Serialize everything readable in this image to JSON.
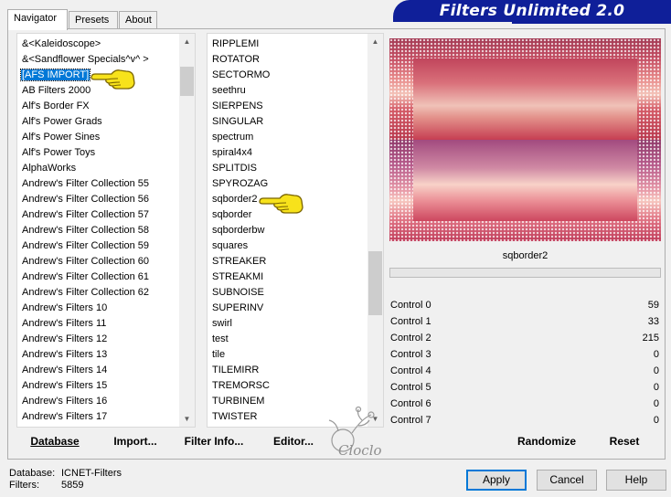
{
  "tabs": [
    {
      "label": "Navigator",
      "active": true
    },
    {
      "label": "Presets",
      "active": false
    },
    {
      "label": "About",
      "active": false
    }
  ],
  "brand": "Filters Unlimited 2.0",
  "categories": [
    "&<Kaleidoscope>",
    "&<Sandflower Specials^v^ >",
    "[AFS IMPORT]",
    "AB Filters 2000",
    "Alf's Border FX",
    "Alf's Power Grads",
    "Alf's Power Sines",
    "Alf's Power Toys",
    "AlphaWorks",
    "Andrew's Filter Collection 55",
    "Andrew's Filter Collection 56",
    "Andrew's Filter Collection 57",
    "Andrew's Filter Collection 58",
    "Andrew's Filter Collection 59",
    "Andrew's Filter Collection 60",
    "Andrew's Filter Collection 61",
    "Andrew's Filter Collection 62",
    "Andrew's Filters 10",
    "Andrew's Filters 11",
    "Andrew's Filters 12",
    "Andrew's Filters 13",
    "Andrew's Filters 14",
    "Andrew's Filters 15",
    "Andrew's Filters 16",
    "Andrew's Filters 17"
  ],
  "selected_category_index": 2,
  "filters": [
    "RIPPLEMI",
    "ROTATOR",
    "SECTORMO",
    "seethru",
    "SIERPENS",
    "SINGULAR",
    "spectrum",
    "spiral4x4",
    "SPLITDIS",
    "SPYROZAG",
    "sqborder2",
    "sqborder",
    "sqborderbw",
    "squares",
    "STREAKER",
    "STREAKMI",
    "SUBNOISE",
    "SUPERINV",
    "swirl",
    "test",
    "tile",
    "TILEMIRR",
    "TREMORSC",
    "TURBINEM",
    "TWISTER"
  ],
  "selected_filter": "sqborder2",
  "preview_title": "sqborder2",
  "progress_fraction": 0,
  "controls": [
    {
      "name": "Control 0",
      "value": "59"
    },
    {
      "name": "Control 1",
      "value": "33"
    },
    {
      "name": "Control 2",
      "value": "215"
    },
    {
      "name": "Control 3",
      "value": "0"
    },
    {
      "name": "Control 4",
      "value": "0"
    },
    {
      "name": "Control 5",
      "value": "0"
    },
    {
      "name": "Control 6",
      "value": "0"
    },
    {
      "name": "Control 7",
      "value": "0"
    }
  ],
  "bottom_buttons": {
    "database": "Database",
    "import": "Import...",
    "filter_info": "Filter Info...",
    "editor": "Editor...",
    "randomize": "Randomize",
    "reset": "Reset"
  },
  "footer": {
    "database_label": "Database:",
    "database_value": "ICNET-Filters",
    "filters_label": "Filters:",
    "filters_value": "5859"
  },
  "dialog_buttons": {
    "apply": "Apply",
    "cancel": "Cancel",
    "help": "Help"
  },
  "watermark_text": "Cloclo",
  "colors": {
    "brand_bg": "#0f1f99",
    "selection": "#0078d7",
    "pointer": "#f7e21b"
  },
  "icons": [
    "pointing-hand-icon",
    "scroll-up-arrow-icon",
    "scroll-down-arrow-icon"
  ]
}
